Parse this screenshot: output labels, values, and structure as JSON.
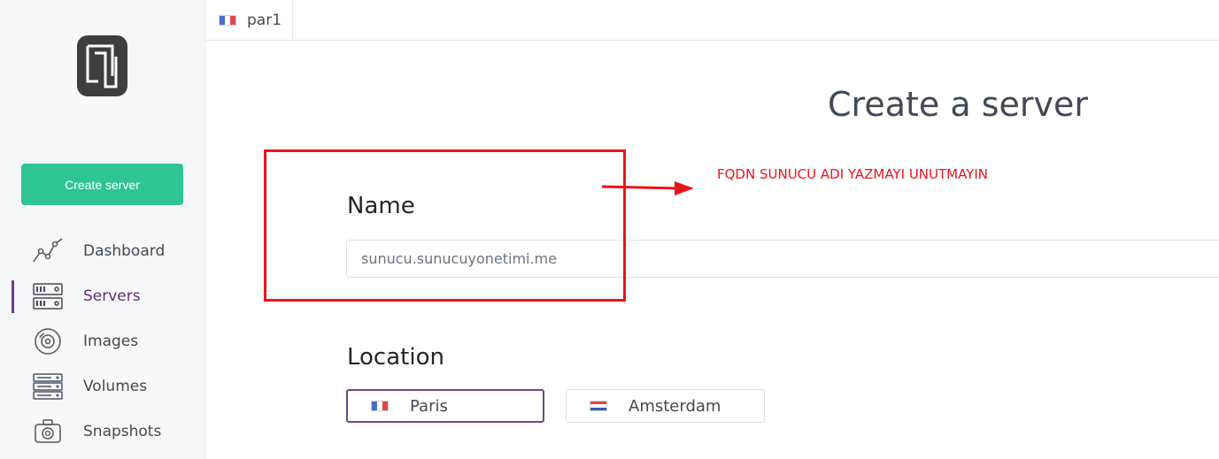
{
  "sidebar": {
    "create_button": "Create server",
    "nav": [
      {
        "label": "Dashboard",
        "icon": "dashboard-icon",
        "active": false
      },
      {
        "label": "Servers",
        "icon": "servers-icon",
        "active": true
      },
      {
        "label": "Images",
        "icon": "images-icon",
        "active": false
      },
      {
        "label": "Volumes",
        "icon": "volumes-icon",
        "active": false
      },
      {
        "label": "Snapshots",
        "icon": "snapshots-icon",
        "active": false
      }
    ]
  },
  "tab": {
    "label": "par1",
    "flag": "france-flag-icon"
  },
  "main": {
    "title": "Create a server",
    "name_label": "Name",
    "name_value": "sunucu.sunucuyonetimi.me",
    "location_label": "Location",
    "locations": [
      {
        "label": "Paris",
        "flag": "france-flag-icon",
        "selected": true
      },
      {
        "label": "Amsterdam",
        "flag": "netherlands-flag-icon",
        "selected": false
      }
    ]
  },
  "annotation": {
    "text": "FQDN SUNUCU ADI YAZMAYI UNUTMAYIN",
    "color": "#e8151c"
  },
  "colors": {
    "accent_green": "#2ec495",
    "active_purple": "#6c3b8b",
    "sidebar_bg": "#f7f8f9"
  }
}
